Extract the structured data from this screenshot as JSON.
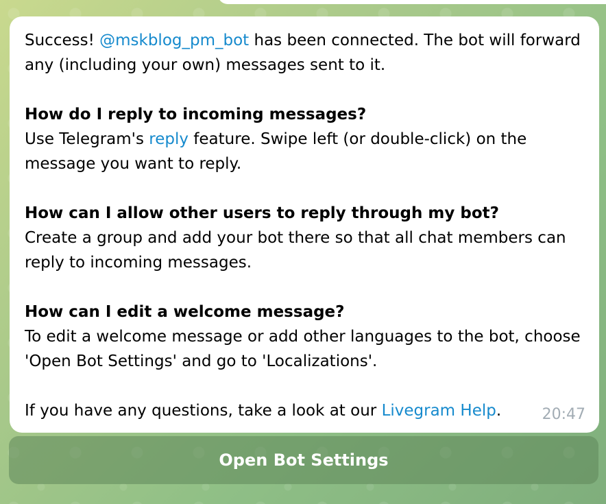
{
  "message": {
    "intro_prefix": "Success! ",
    "bot_username": "@mskblog_pm_bot",
    "intro_suffix": " has been connected. The bot will forward any (including your own) messages sent to it.",
    "reply_question": "How do I reply to incoming messages?",
    "reply_prefix": "Use Telegram's ",
    "reply_link": "reply",
    "reply_suffix": " feature. Swipe left (or double-click) on the message you want to reply.",
    "allow_question": "How can I allow other users to reply through my bot?",
    "allow_answer": "Create a group and add your bot there so that all chat members can reply to incoming messages.",
    "edit_question": "How can I edit a welcome message?",
    "edit_answer": "To edit a welcome message or add other languages to the bot, choose 'Open Bot Settings' and go to 'Localizations'.",
    "help_prefix": "If you have any questions, take a look at our ",
    "help_link": "Livegram Help",
    "help_suffix": ".",
    "time": "20:47"
  },
  "inline_button": {
    "label": "Open Bot Settings"
  }
}
